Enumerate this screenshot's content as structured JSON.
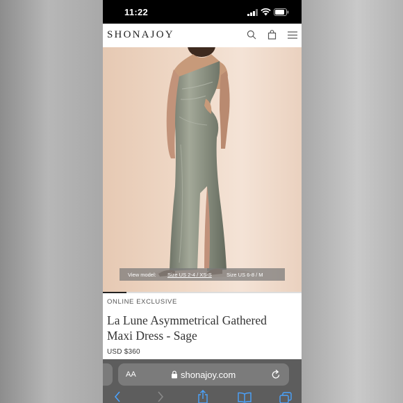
{
  "status_bar": {
    "time": "11:22"
  },
  "header": {
    "logo": "SHONAJOY",
    "icons": [
      "search-icon",
      "bag-icon",
      "menu-icon"
    ]
  },
  "hero": {
    "size_bar": {
      "view_model_label": "View model:",
      "option_1": "Size US 2-4 / XS-S",
      "option_2": "Size US 6-8 / M",
      "selected": "Size US 2-4 / XS-S"
    },
    "image_progress": 0.12
  },
  "product": {
    "badge": "ONLINE EXCLUSIVE",
    "title": "La Lune Asymmetrical Gathered Maxi Dress - Sage",
    "price": "USD $360"
  },
  "browser": {
    "text_size_label": "AA",
    "domain": "shonajoy.com",
    "toolbar": [
      "back-icon",
      "forward-icon",
      "share-icon",
      "bookmarks-icon",
      "tabs-icon"
    ]
  },
  "colors": {
    "page_bg": "#ffffff",
    "hero_bg": "#efd8c6",
    "dress": "#8a9181",
    "safari_bar": "#5d5d5d"
  }
}
